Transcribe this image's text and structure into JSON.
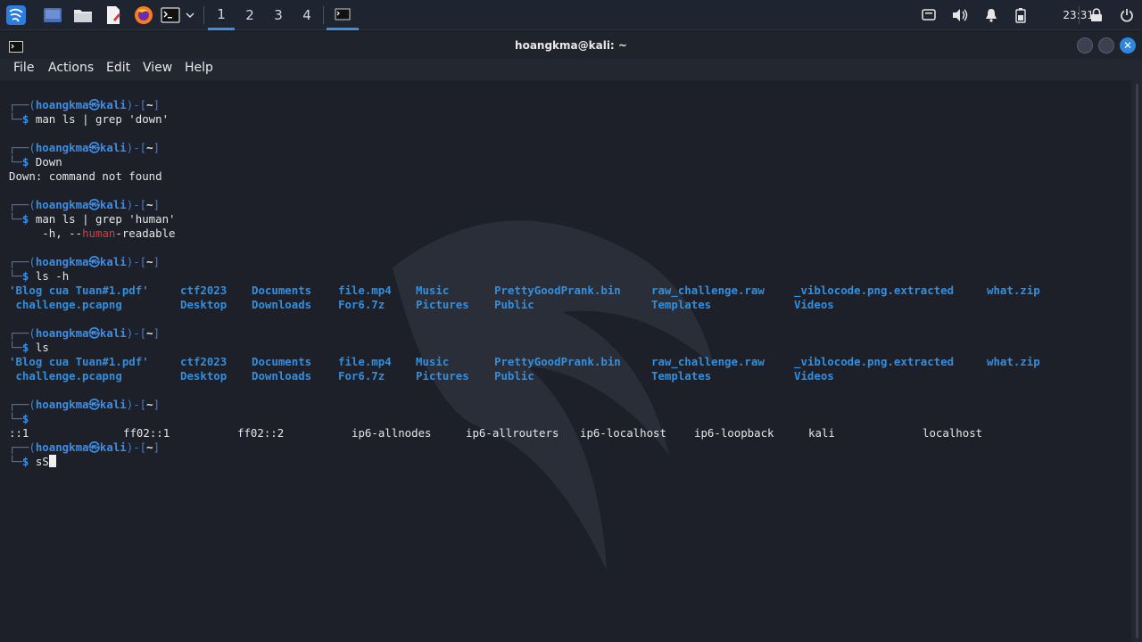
{
  "taskbar": {
    "workspaces": [
      "1",
      "2",
      "3",
      "4"
    ],
    "active_workspace": "1",
    "clock": "23:31",
    "icons": [
      "kali-menu-icon",
      "desktop-icon",
      "files-icon",
      "text-editor-icon",
      "firefox-icon",
      "terminal-icon",
      "dropdown-icon",
      "terminal-task-icon",
      "screen-icon",
      "volume-icon",
      "bell-icon",
      "battery-icon",
      "lock-icon",
      "power-icon"
    ]
  },
  "window": {
    "title": "hoangkma@kali: ~",
    "menu": [
      "File",
      "Actions",
      "Edit",
      "View",
      "Help"
    ]
  },
  "prompt": {
    "user_host_user": "hoangkma",
    "at_symbol": "㉿",
    "host": "kali",
    "path": "~",
    "dollar": "$"
  },
  "terminal": {
    "cmd1": "man ls | grep 'down'",
    "cmd2": "Down",
    "out2": "Down: command not found",
    "cmd3": "man ls | grep 'human'",
    "out3_pre": "     -h, --",
    "out3_hl": "human",
    "out3_post": "-readable",
    "cmd4": "ls -h",
    "cmd5": "ls",
    "cmd6": "",
    "cmd7": "sS",
    "ls_row1": [
      "'Blog cua Tuan#1.pdf'",
      "ctf2023",
      "Documents",
      "file.mp4",
      "Music",
      "PrettyGoodPrank.bin",
      "raw_challenge.raw",
      "_viblocode.png.extracted",
      "what.zip"
    ],
    "ls_row2": [
      " challenge.pcapng",
      "Desktop",
      "Downloads",
      "For6.7z",
      "Pictures",
      "Public",
      "Templates",
      "Videos"
    ],
    "hosts_row": [
      "::1",
      "ff02::1",
      "ff02::2",
      "ip6-allnodes",
      "ip6-allrouters",
      "ip6-localhost",
      "ip6-loopback",
      "kali",
      "localhost"
    ]
  }
}
